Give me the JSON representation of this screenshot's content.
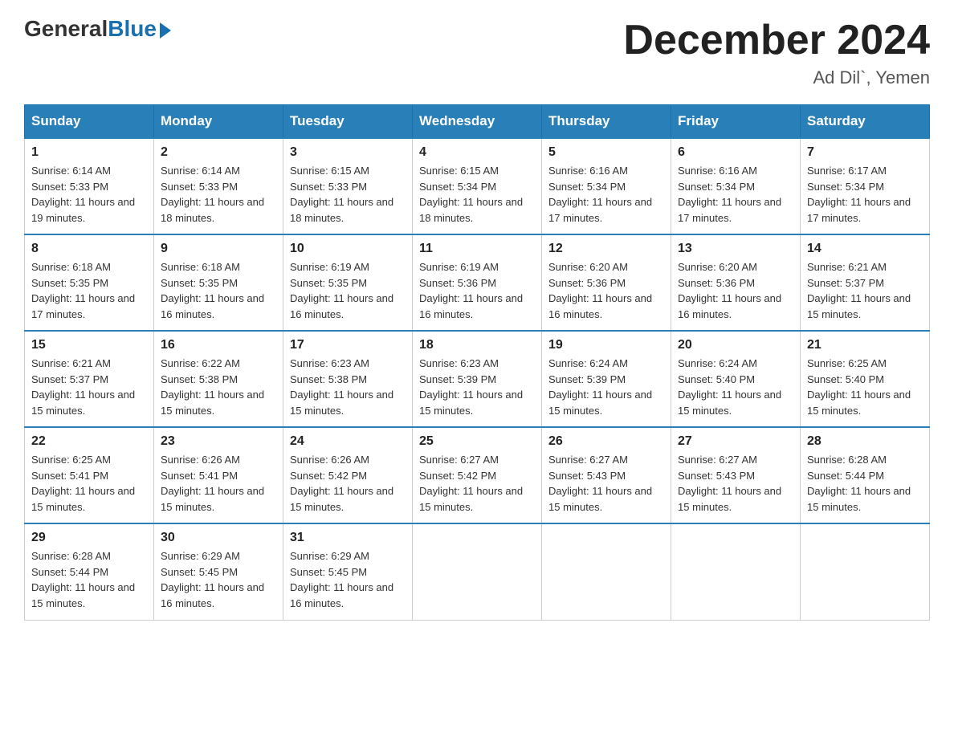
{
  "header": {
    "logo": {
      "general": "General",
      "blue": "Blue"
    },
    "title": "December 2024",
    "location": "Ad Dil`, Yemen"
  },
  "calendar": {
    "weekdays": [
      "Sunday",
      "Monday",
      "Tuesday",
      "Wednesday",
      "Thursday",
      "Friday",
      "Saturday"
    ],
    "weeks": [
      [
        {
          "day": "1",
          "sunrise": "6:14 AM",
          "sunset": "5:33 PM",
          "daylight": "11 hours and 19 minutes."
        },
        {
          "day": "2",
          "sunrise": "6:14 AM",
          "sunset": "5:33 PM",
          "daylight": "11 hours and 18 minutes."
        },
        {
          "day": "3",
          "sunrise": "6:15 AM",
          "sunset": "5:33 PM",
          "daylight": "11 hours and 18 minutes."
        },
        {
          "day": "4",
          "sunrise": "6:15 AM",
          "sunset": "5:34 PM",
          "daylight": "11 hours and 18 minutes."
        },
        {
          "day": "5",
          "sunrise": "6:16 AM",
          "sunset": "5:34 PM",
          "daylight": "11 hours and 17 minutes."
        },
        {
          "day": "6",
          "sunrise": "6:16 AM",
          "sunset": "5:34 PM",
          "daylight": "11 hours and 17 minutes."
        },
        {
          "day": "7",
          "sunrise": "6:17 AM",
          "sunset": "5:34 PM",
          "daylight": "11 hours and 17 minutes."
        }
      ],
      [
        {
          "day": "8",
          "sunrise": "6:18 AM",
          "sunset": "5:35 PM",
          "daylight": "11 hours and 17 minutes."
        },
        {
          "day": "9",
          "sunrise": "6:18 AM",
          "sunset": "5:35 PM",
          "daylight": "11 hours and 16 minutes."
        },
        {
          "day": "10",
          "sunrise": "6:19 AM",
          "sunset": "5:35 PM",
          "daylight": "11 hours and 16 minutes."
        },
        {
          "day": "11",
          "sunrise": "6:19 AM",
          "sunset": "5:36 PM",
          "daylight": "11 hours and 16 minutes."
        },
        {
          "day": "12",
          "sunrise": "6:20 AM",
          "sunset": "5:36 PM",
          "daylight": "11 hours and 16 minutes."
        },
        {
          "day": "13",
          "sunrise": "6:20 AM",
          "sunset": "5:36 PM",
          "daylight": "11 hours and 16 minutes."
        },
        {
          "day": "14",
          "sunrise": "6:21 AM",
          "sunset": "5:37 PM",
          "daylight": "11 hours and 15 minutes."
        }
      ],
      [
        {
          "day": "15",
          "sunrise": "6:21 AM",
          "sunset": "5:37 PM",
          "daylight": "11 hours and 15 minutes."
        },
        {
          "day": "16",
          "sunrise": "6:22 AM",
          "sunset": "5:38 PM",
          "daylight": "11 hours and 15 minutes."
        },
        {
          "day": "17",
          "sunrise": "6:23 AM",
          "sunset": "5:38 PM",
          "daylight": "11 hours and 15 minutes."
        },
        {
          "day": "18",
          "sunrise": "6:23 AM",
          "sunset": "5:39 PM",
          "daylight": "11 hours and 15 minutes."
        },
        {
          "day": "19",
          "sunrise": "6:24 AM",
          "sunset": "5:39 PM",
          "daylight": "11 hours and 15 minutes."
        },
        {
          "day": "20",
          "sunrise": "6:24 AM",
          "sunset": "5:40 PM",
          "daylight": "11 hours and 15 minutes."
        },
        {
          "day": "21",
          "sunrise": "6:25 AM",
          "sunset": "5:40 PM",
          "daylight": "11 hours and 15 minutes."
        }
      ],
      [
        {
          "day": "22",
          "sunrise": "6:25 AM",
          "sunset": "5:41 PM",
          "daylight": "11 hours and 15 minutes."
        },
        {
          "day": "23",
          "sunrise": "6:26 AM",
          "sunset": "5:41 PM",
          "daylight": "11 hours and 15 minutes."
        },
        {
          "day": "24",
          "sunrise": "6:26 AM",
          "sunset": "5:42 PM",
          "daylight": "11 hours and 15 minutes."
        },
        {
          "day": "25",
          "sunrise": "6:27 AM",
          "sunset": "5:42 PM",
          "daylight": "11 hours and 15 minutes."
        },
        {
          "day": "26",
          "sunrise": "6:27 AM",
          "sunset": "5:43 PM",
          "daylight": "11 hours and 15 minutes."
        },
        {
          "day": "27",
          "sunrise": "6:27 AM",
          "sunset": "5:43 PM",
          "daylight": "11 hours and 15 minutes."
        },
        {
          "day": "28",
          "sunrise": "6:28 AM",
          "sunset": "5:44 PM",
          "daylight": "11 hours and 15 minutes."
        }
      ],
      [
        {
          "day": "29",
          "sunrise": "6:28 AM",
          "sunset": "5:44 PM",
          "daylight": "11 hours and 15 minutes."
        },
        {
          "day": "30",
          "sunrise": "6:29 AM",
          "sunset": "5:45 PM",
          "daylight": "11 hours and 16 minutes."
        },
        {
          "day": "31",
          "sunrise": "6:29 AM",
          "sunset": "5:45 PM",
          "daylight": "11 hours and 16 minutes."
        },
        null,
        null,
        null,
        null
      ]
    ]
  }
}
